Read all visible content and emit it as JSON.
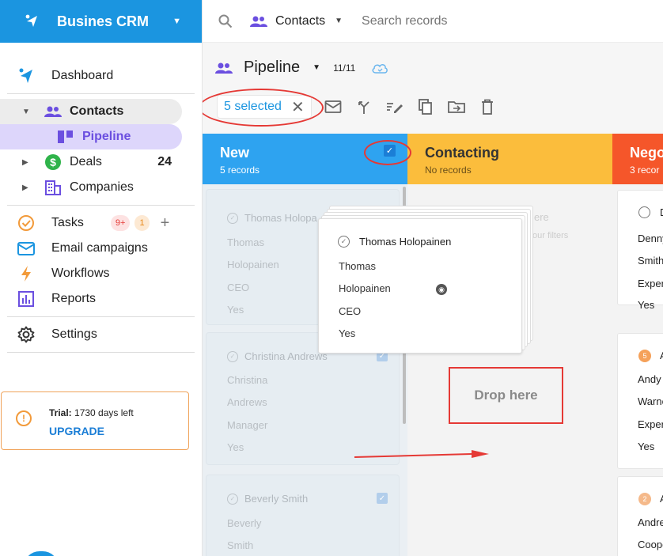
{
  "app": {
    "name": "Busines CRM"
  },
  "sidebar": {
    "items": [
      {
        "label": "Dashboard"
      },
      {
        "label": "Contacts"
      },
      {
        "label": "Pipeline"
      },
      {
        "label": "Deals",
        "count": "24"
      },
      {
        "label": "Companies"
      },
      {
        "label": "Tasks",
        "badge_red": "9+",
        "badge_orange": "1"
      },
      {
        "label": "Email campaigns"
      },
      {
        "label": "Workflows"
      },
      {
        "label": "Reports"
      },
      {
        "label": "Settings"
      }
    ],
    "trial": {
      "label": "Trial:",
      "days": "1730 days left",
      "upgrade": "UPGRADE"
    }
  },
  "topbar": {
    "entity": "Contacts",
    "search_placeholder": "Search records"
  },
  "pipeline": {
    "title": "Pipeline",
    "count": "11/11"
  },
  "toolbar": {
    "selected": "5 selected"
  },
  "columns": {
    "new": {
      "name": "New",
      "sub": "5 records"
    },
    "contacting": {
      "name": "Contacting",
      "sub": "No records",
      "ghost_1": "ere",
      "ghost_2": "our filters",
      "drop": "Drop here"
    },
    "nego": {
      "name": "Nego",
      "sub": "3 recor"
    }
  },
  "cards_new": [
    {
      "name": "Thomas Holopainen",
      "name_visible": "Thomas Holopa",
      "first": "Thomas",
      "last": "Holopainen",
      "title": "CEO",
      "flag": "Yes"
    },
    {
      "name": "Christina Andrews",
      "first": "Christina",
      "last": "Andrews",
      "title": "Manager",
      "flag": "Yes"
    },
    {
      "name": "Beverly Smith",
      "first": "Beverly",
      "last": "Smith"
    }
  ],
  "drag_card": {
    "name": "Thomas Holopainen",
    "first": "Thomas",
    "last": "Holopainen",
    "title": "CEO",
    "flag": "Yes"
  },
  "cards_nego": [
    {
      "head": "D",
      "r1": "Denny",
      "r2": "Smith",
      "r3": "Exper",
      "r4": "Yes"
    },
    {
      "num": "5",
      "head": "A",
      "r1": "Andy",
      "r2": "Warne",
      "r3": "Exper",
      "r4": "Yes"
    },
    {
      "num": "2",
      "head": "A",
      "r1": "Andre",
      "r2": "Coope"
    }
  ],
  "colors": {
    "brand": "#1b95e0",
    "new": "#2ea3f0",
    "contacting": "#fbbd3c",
    "nego": "#f5562a",
    "annotation": "#e53935",
    "accent": "#6b4fe0"
  }
}
